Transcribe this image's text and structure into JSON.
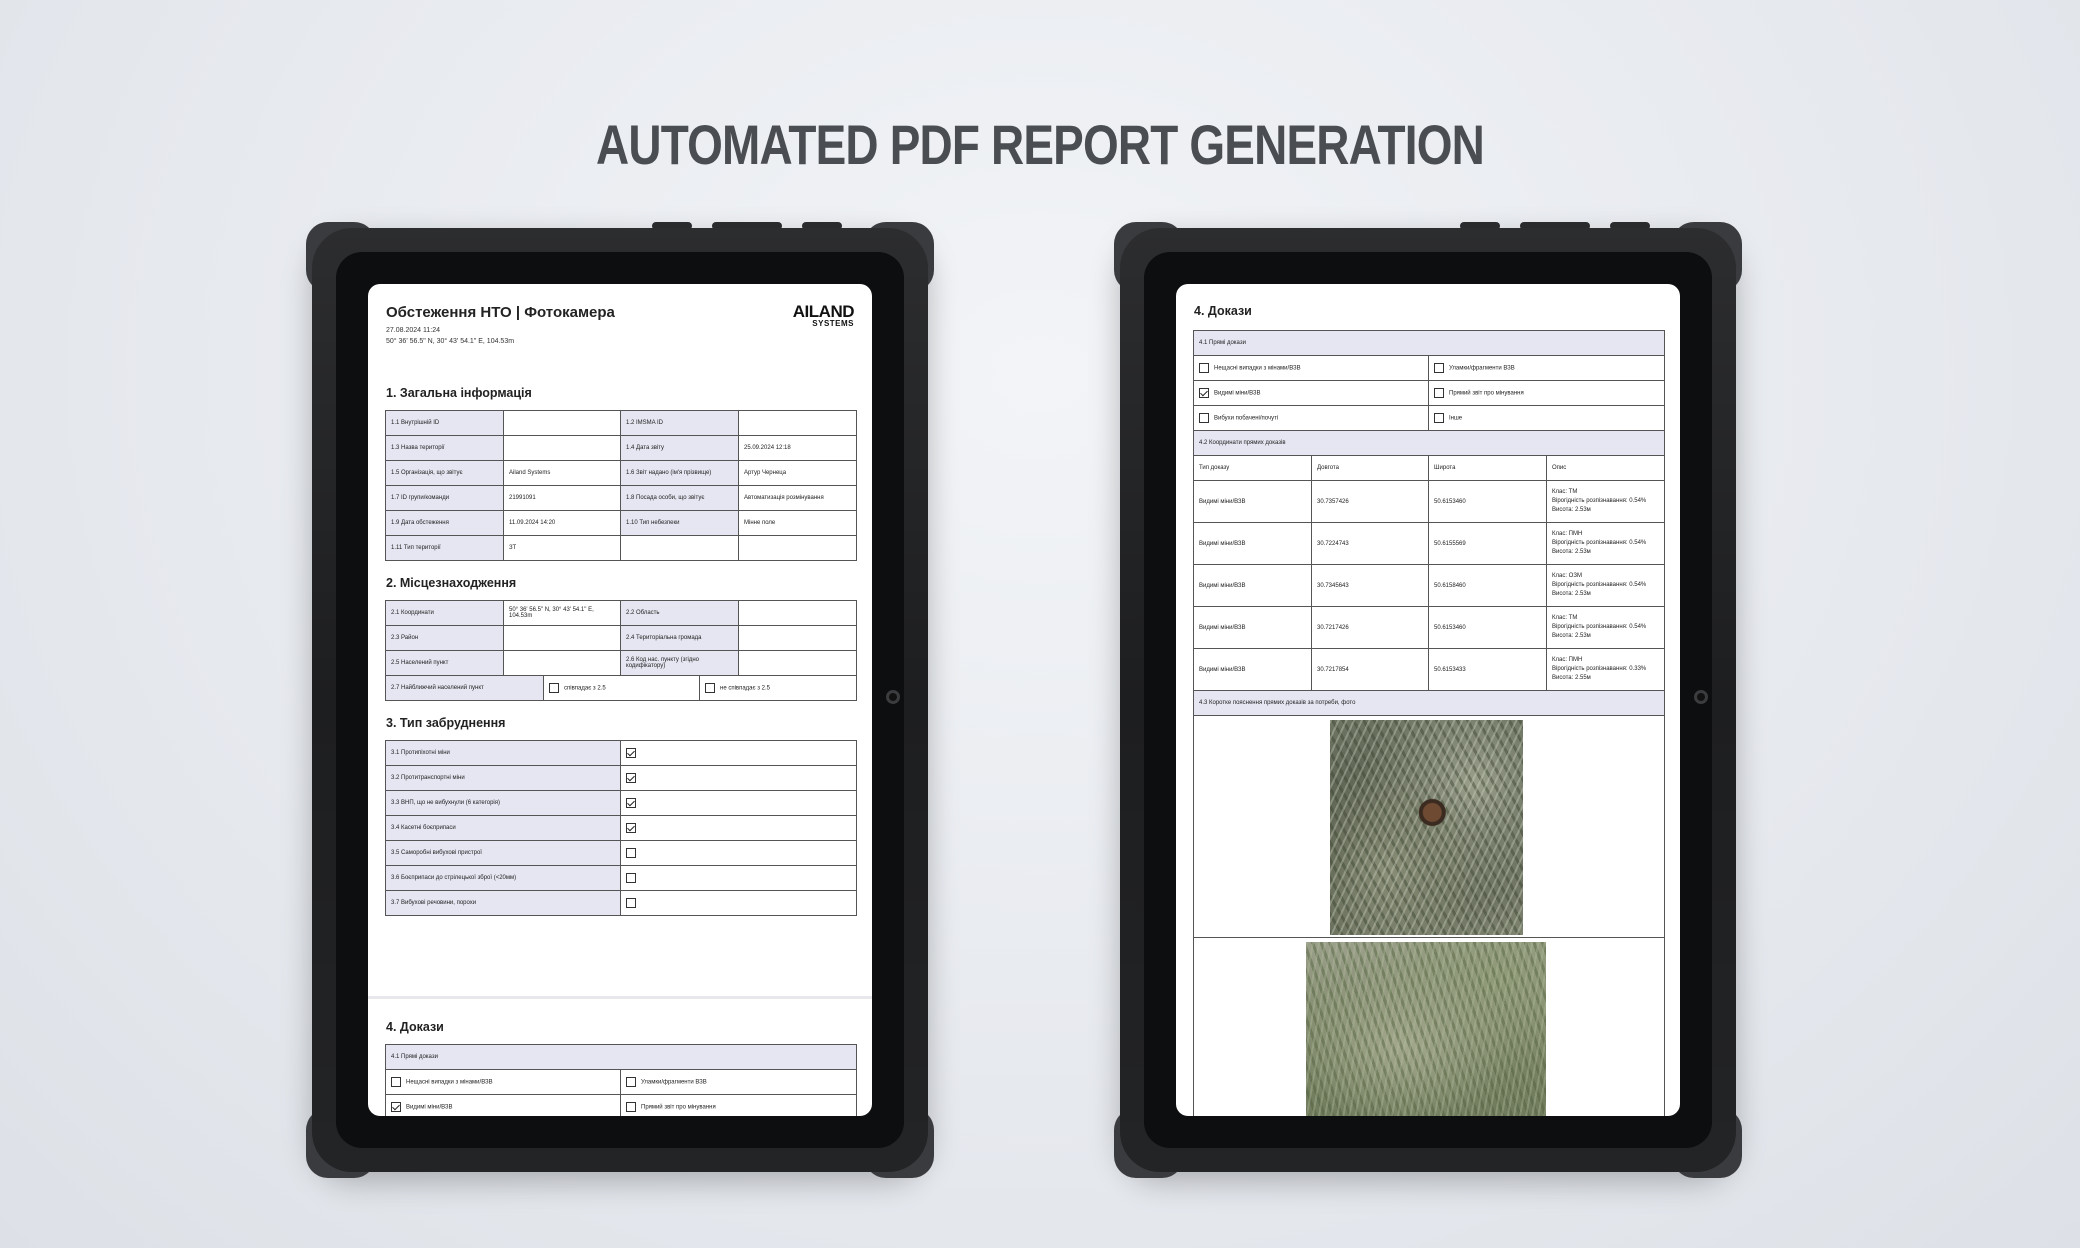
{
  "headline": "AUTOMATED PDF REPORT GENERATION",
  "left_doc": {
    "title": "Обстеження НТО | Фотокамера",
    "date": "27.08.2024 11:24",
    "coords": "50° 36' 56.5\" N, 30° 43' 54.1\" E, 104.53m",
    "logo_main": "AILAND",
    "logo_sub": "SYSTEMS",
    "s1_title": "1. Загальна інформація",
    "s1_rows": [
      [
        "1.1 Внутрішній ID",
        "",
        "1.2 IMSMA ID",
        ""
      ],
      [
        "1.3 Назва території",
        "",
        "1.4 Дата звіту",
        "25.09.2024 12:18"
      ],
      [
        "1.5 Організація, що звітує",
        "Ailand Systems",
        "1.6 Звіт надано (ім'я прізвище)",
        "Артур Чернеца"
      ],
      [
        "1.7 ID групи/команди",
        "21991091",
        "1.8 Посада особи, що звітує",
        "Автоматизація розмінування"
      ],
      [
        "1.9 Дата обстеження",
        "11.09.2024 14:20",
        "1.10 Тип небезпеки",
        "Мінне поле"
      ],
      [
        "1.11 Тип території",
        "ЗТ",
        "",
        ""
      ]
    ],
    "s2_title": "2. Місцезнаходження",
    "s2_rows": [
      [
        "2.1 Координати",
        "50° 36' 56.5\" N, 30° 43' 54.1\" E, 104.53m",
        "2.2 Область",
        ""
      ],
      [
        "2.3 Район",
        "",
        "2.4 Територіальна громада",
        ""
      ],
      [
        "2.5 Населений пункт",
        "",
        "2.6 Код нас. пункту (згідно кодифікатору)",
        ""
      ]
    ],
    "s2_row4_label": "2.7 Найближчий населений пункт",
    "s2_row4_opt1": "співпадає з 2.5",
    "s2_row4_opt2": "не співпадає з 2.5",
    "s3_title": "3. Тип забруднення",
    "s3_rows": [
      {
        "label": "3.1 Протипіхотні міни",
        "checked": true
      },
      {
        "label": "3.2 Протитранспортні міни",
        "checked": true
      },
      {
        "label": "3.3 ВНП, що не вибухнули (6 категорія)",
        "checked": true
      },
      {
        "label": "3.4 Касетні боєприпаси",
        "checked": true
      },
      {
        "label": "3.5 Саморобні вибухові пристрої",
        "checked": false
      },
      {
        "label": "3.6 Боєприпаси до стрілецької зброї (<20мм)",
        "checked": false
      },
      {
        "label": "3.7 Вибухові речовини, порохи",
        "checked": false
      }
    ],
    "s4_title": "4. Докази",
    "s4_sub": "4.1 Прямі докази",
    "s4_rows": [
      [
        {
          "label": "Нещасні випадки з мінами/ВЗВ",
          "checked": false
        },
        {
          "label": "Уламки/фрагменти ВЗВ",
          "checked": false
        }
      ],
      [
        {
          "label": "Видимі міни/ВЗВ",
          "checked": true
        },
        {
          "label": "Прямий звіт про мінування",
          "checked": false
        }
      ]
    ]
  },
  "right_doc": {
    "title": "4. Докази",
    "sub1": "4.1 Прямі докази",
    "evidence": [
      [
        {
          "label": "Нещасні випадки з мінами/ВЗВ",
          "checked": false
        },
        {
          "label": "Уламки/фрагменти ВЗВ",
          "checked": false
        }
      ],
      [
        {
          "label": "Видимі міни/ВЗВ",
          "checked": true
        },
        {
          "label": "Прямий звіт про мінування",
          "checked": false
        }
      ],
      [
        {
          "label": "Вибухи побачені/почуті",
          "checked": false
        },
        {
          "label": "Інше",
          "checked": false
        }
      ]
    ],
    "sub2": "4.2 Координати прямих доказів",
    "coord_headers": [
      "Тип доказу",
      "Довгота",
      "Широта",
      "Опис"
    ],
    "coord_rows": [
      {
        "type": "Видимі міни/ВЗВ",
        "lon": "30.7357426",
        "lat": "50.6153460",
        "d1": "Клас: ТМ",
        "d2": "Вірогідність розпізнавання: 0.54%",
        "d3": "Висота: 2.53м"
      },
      {
        "type": "Видимі міни/ВЗВ",
        "lon": "30.7224743",
        "lat": "50.6155569",
        "d1": "Клас: ПМН",
        "d2": "Вірогідність розпізнавання: 0.54%",
        "d3": "Висота: 2.53м"
      },
      {
        "type": "Видимі міни/ВЗВ",
        "lon": "30.7345643",
        "lat": "50.6158460",
        "d1": "Клас: ОЗМ",
        "d2": "Вірогідність розпізнавання: 0.54%",
        "d3": "Висота: 2.53м"
      },
      {
        "type": "Видимі міни/ВЗВ",
        "lon": "30.7217426",
        "lat": "50.6153460",
        "d1": "Клас: ТМ",
        "d2": "Вірогідність розпізнавання: 0.54%",
        "d3": "Висота: 2.53м"
      },
      {
        "type": "Видимі міни/ВЗВ",
        "lon": "30.7217854",
        "lat": "50.6153433",
        "d1": "Клас: ПМН",
        "d2": "Вірогідність розпізнавання: 0.33%",
        "d3": "Висота: 2.55м"
      }
    ],
    "sub3": "4.3 Коротке пояснення прямих доказів за потреби, фото"
  }
}
